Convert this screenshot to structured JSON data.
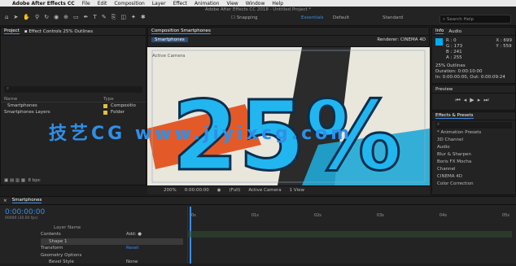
{
  "menubar": {
    "app": "Adobe After Effects CC",
    "items": [
      "File",
      "Edit",
      "Composition",
      "Layer",
      "Effect",
      "Animation",
      "View",
      "Window",
      "Help"
    ],
    "clock": ""
  },
  "window_title": "Adobe After Effects CC 2018 - Untitled Project *",
  "toolbar": {
    "snapping": "Snapping",
    "essentials": "Essentials",
    "default": "Default",
    "standard": "Standard",
    "search_placeholder": "Search Help"
  },
  "project": {
    "tab": "Project",
    "effect_controls_tab": "Effect Controls 25% Outlines",
    "search_icon": "⌕",
    "col_name": "Name",
    "col_type": "Type",
    "items": [
      {
        "name": "Smartphones",
        "type": "Compositio"
      },
      {
        "name": "Smartphones Layers",
        "type": "Folder"
      }
    ],
    "bpc": "8 bpc"
  },
  "composition": {
    "tab": "Composition Smartphones",
    "subtab": "Smartphones",
    "renderer_label": "Renderer:",
    "renderer": "CINEMA 4D",
    "camera_label": "Active Camera",
    "overlay_text": "25%",
    "zoom": "200%",
    "timecode": "0:00:00:00",
    "resolution": "(Full)",
    "view": "Active Camera",
    "views": "1 View"
  },
  "info": {
    "tab": "Info",
    "audio_tab": "Audio",
    "r": "R : 0",
    "g": "G : 173",
    "b": "B : 241",
    "a": "A : 255",
    "x": "X : 699",
    "y": "Y : 559",
    "layer": "25% Outlines",
    "duration": "Duration: 0:00:10:00",
    "inout": "In: 0:00:00:00, Out: 0:00:09:24"
  },
  "preview": {
    "tab": "Preview"
  },
  "effects": {
    "tab": "Effects & Presets",
    "search": "",
    "items": [
      "* Animation Presets",
      "3D Channel",
      "Audio",
      "Blur & Sharpen",
      "Boris FX Mocha",
      "Channel",
      "CINEMA 4D",
      "Color Correction"
    ]
  },
  "timeline": {
    "comp": "Smartphones",
    "timecode": "0:00:00:00",
    "fps": "00000 (30.00 fps)",
    "col_layer": "Layer Name",
    "ruler": [
      "0s",
      "01s",
      "02s",
      "03s",
      "04s",
      "05s"
    ],
    "rows": [
      {
        "label": "Contents",
        "value": "Add: ●"
      },
      {
        "label": "Shape 1",
        "value": ""
      },
      {
        "label": "Transform",
        "value": "Reset"
      },
      {
        "label": "Geometry Options",
        "value": ""
      },
      {
        "label": "Bevel Style",
        "value": "None"
      }
    ]
  },
  "watermark": "技艺CG www.jiyixcg.com",
  "colors": {
    "accent": "#2f8fe8",
    "cyan": "#00adf1",
    "orange": "#e85a2a"
  }
}
